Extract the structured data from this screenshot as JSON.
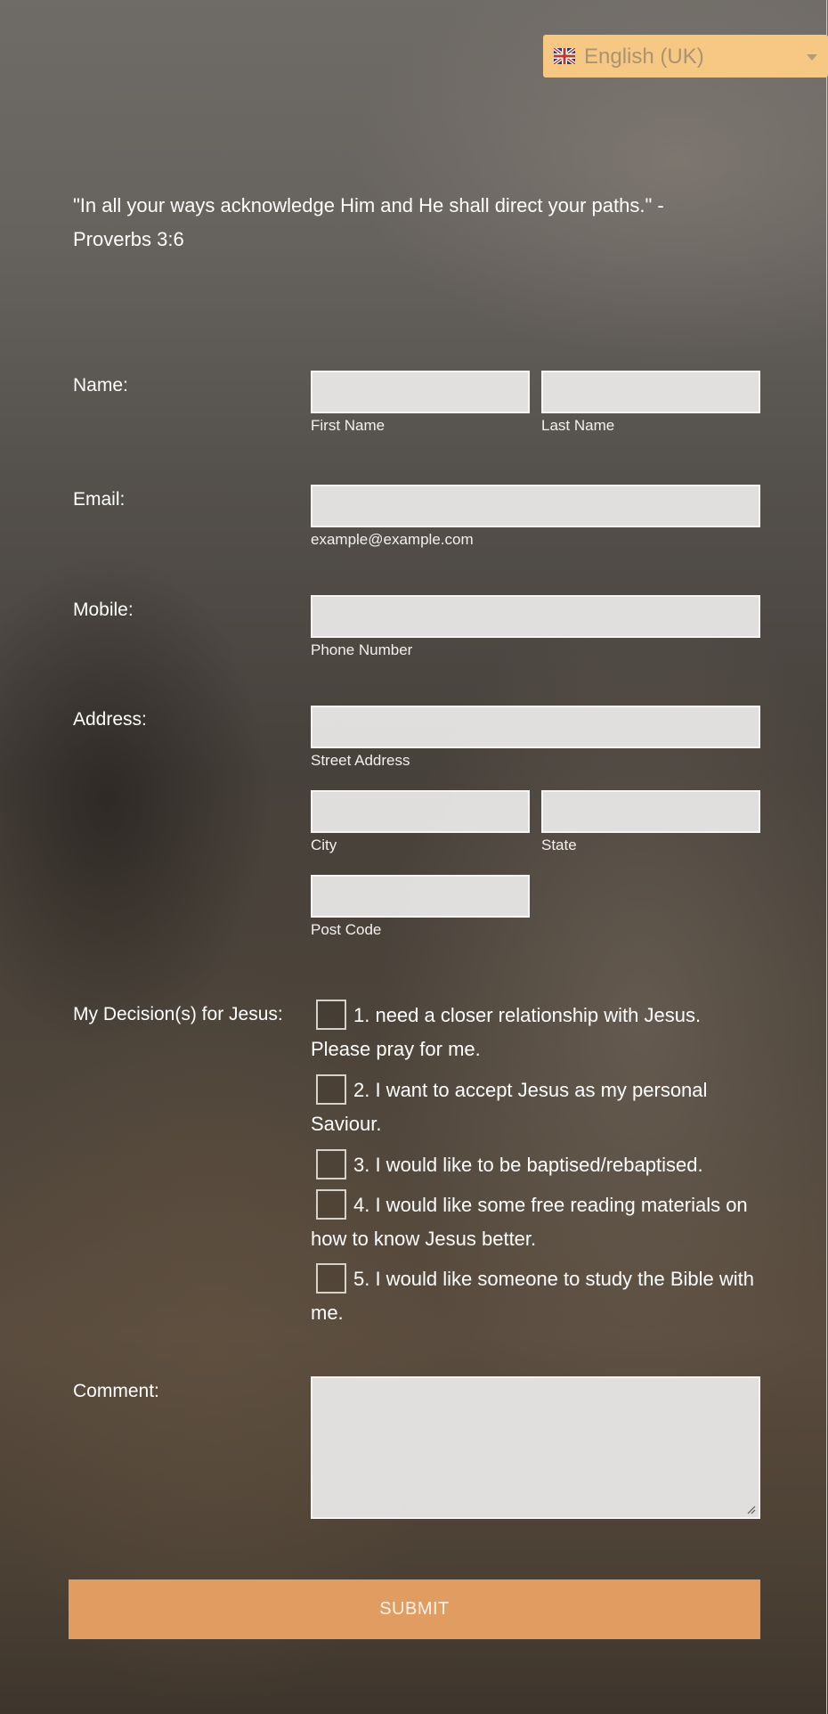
{
  "language": {
    "selected": "English (UK)",
    "flag_icon": "uk-flag-icon"
  },
  "quote": "\"In all your ways acknowledge Him and He shall direct your paths.\" - Proverbs 3:6",
  "form": {
    "name": {
      "label": "Name:",
      "first_sublabel": "First Name",
      "last_sublabel": "Last Name"
    },
    "email": {
      "label": "Email:",
      "sublabel": "example@example.com"
    },
    "mobile": {
      "label": "Mobile:",
      "sublabel": "Phone Number"
    },
    "address": {
      "label": "Address:",
      "street_sublabel": "Street Address",
      "city_sublabel": "City",
      "state_sublabel": "State",
      "postcode_sublabel": "Post Code"
    },
    "decisions": {
      "label": "My Decision(s) for Jesus:",
      "options": [
        "1. need a closer relationship with Jesus. Please pray for me.",
        "2. I want to accept Jesus as my personal Saviour.",
        "3. I would like to be baptised/rebaptised.",
        "4. I would like some free reading materials on how to know Jesus better.",
        "5. I would like someone to study the Bible with me."
      ]
    },
    "comment": {
      "label": "Comment:"
    },
    "submit_label": "SUBMIT"
  },
  "colors": {
    "accent": "#e19c62",
    "language_bg": "#f7c883"
  }
}
